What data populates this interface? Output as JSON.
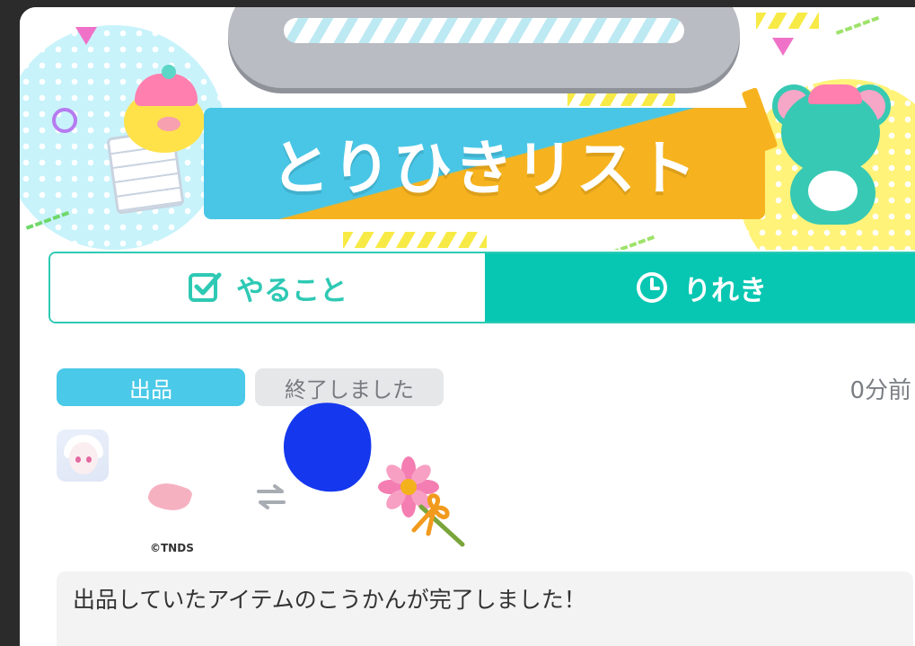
{
  "header": {
    "title": "とりひきリスト"
  },
  "tabs": [
    {
      "label": "やること",
      "icon": "checkbox-icon",
      "active": false
    },
    {
      "label": "りれき",
      "icon": "clock-icon",
      "active": true
    }
  ],
  "entry": {
    "type_badge": "出品",
    "status_badge": "終了しました",
    "time_ago": "0分前",
    "copyright": "©TNDS",
    "message": "出品していたアイテムのこうかんが完了しました！",
    "swap_icon": "swap-arrows-icon"
  },
  "colors": {
    "accent_teal": "#07c7b2",
    "badge_blue": "#4ac9e8",
    "status_gray": "#e6e7e9",
    "banner_blue": "#49c6e6",
    "banner_orange": "#f6b31f"
  }
}
